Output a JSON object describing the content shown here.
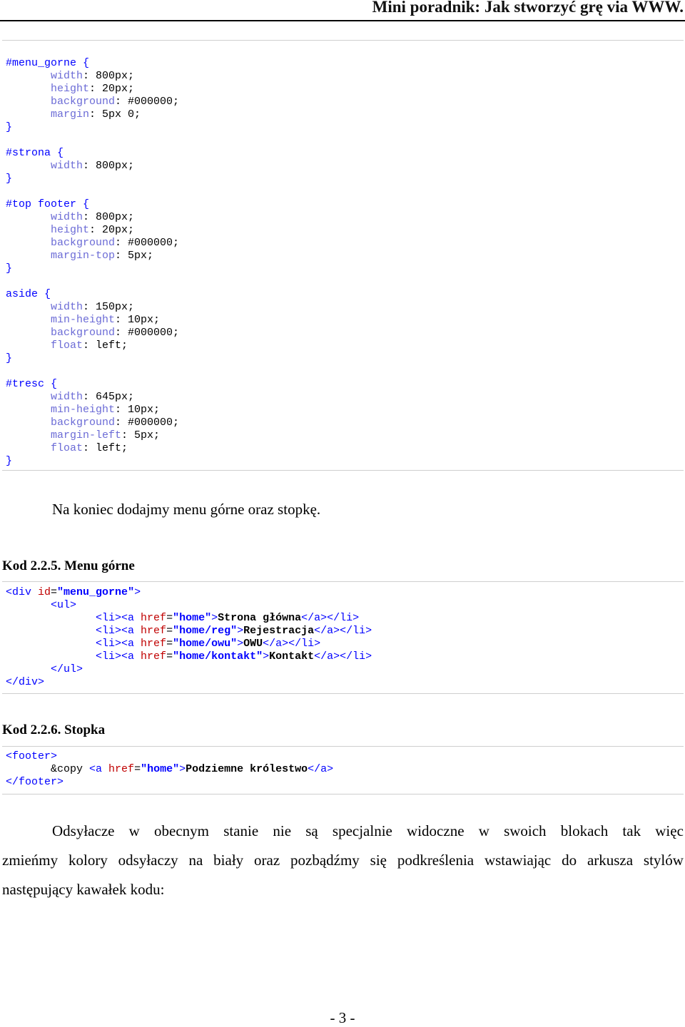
{
  "header": {
    "title": "Mini poradnik: Jak stworzyć grę via WWW."
  },
  "css_code": [
    [
      [
        "c-sel",
        "#menu_gorne {"
      ]
    ],
    [
      [
        "c-plain",
        "       "
      ],
      [
        "c-prop",
        "width"
      ],
      [
        "c-val",
        ": 800px;"
      ]
    ],
    [
      [
        "c-plain",
        "       "
      ],
      [
        "c-prop",
        "height"
      ],
      [
        "c-val",
        ": 20px;"
      ]
    ],
    [
      [
        "c-plain",
        "       "
      ],
      [
        "c-prop",
        "background"
      ],
      [
        "c-val",
        ": #000000;"
      ]
    ],
    [
      [
        "c-plain",
        "       "
      ],
      [
        "c-prop",
        "margin"
      ],
      [
        "c-val",
        ": 5px 0;"
      ]
    ],
    [
      [
        "c-sel",
        "}"
      ]
    ],
    [
      [
        "c-plain",
        ""
      ]
    ],
    [
      [
        "c-sel",
        "#strona {"
      ]
    ],
    [
      [
        "c-plain",
        "       "
      ],
      [
        "c-prop",
        "width"
      ],
      [
        "c-val",
        ": 800px;"
      ]
    ],
    [
      [
        "c-sel",
        "}"
      ]
    ],
    [
      [
        "c-plain",
        ""
      ]
    ],
    [
      [
        "c-sel",
        "#top footer {"
      ]
    ],
    [
      [
        "c-plain",
        "       "
      ],
      [
        "c-prop",
        "width"
      ],
      [
        "c-val",
        ": 800px;"
      ]
    ],
    [
      [
        "c-plain",
        "       "
      ],
      [
        "c-prop",
        "height"
      ],
      [
        "c-val",
        ": 20px;"
      ]
    ],
    [
      [
        "c-plain",
        "       "
      ],
      [
        "c-prop",
        "background"
      ],
      [
        "c-val",
        ": #000000;"
      ]
    ],
    [
      [
        "c-plain",
        "       "
      ],
      [
        "c-prop",
        "margin-top"
      ],
      [
        "c-val",
        ": 5px;"
      ]
    ],
    [
      [
        "c-sel",
        "}"
      ]
    ],
    [
      [
        "c-plain",
        ""
      ]
    ],
    [
      [
        "c-sel",
        "aside {"
      ]
    ],
    [
      [
        "c-plain",
        "       "
      ],
      [
        "c-prop",
        "width"
      ],
      [
        "c-val",
        ": 150px;"
      ]
    ],
    [
      [
        "c-plain",
        "       "
      ],
      [
        "c-prop",
        "min-height"
      ],
      [
        "c-val",
        ": 10px;"
      ]
    ],
    [
      [
        "c-plain",
        "       "
      ],
      [
        "c-prop",
        "background"
      ],
      [
        "c-val",
        ": #000000;"
      ]
    ],
    [
      [
        "c-plain",
        "       "
      ],
      [
        "c-prop",
        "float"
      ],
      [
        "c-val",
        ": left;"
      ]
    ],
    [
      [
        "c-sel",
        "}"
      ]
    ],
    [
      [
        "c-plain",
        ""
      ]
    ],
    [
      [
        "c-sel",
        "#tresc {"
      ]
    ],
    [
      [
        "c-plain",
        "       "
      ],
      [
        "c-prop",
        "width"
      ],
      [
        "c-val",
        ": 645px;"
      ]
    ],
    [
      [
        "c-plain",
        "       "
      ],
      [
        "c-prop",
        "min-height"
      ],
      [
        "c-val",
        ": 10px;"
      ]
    ],
    [
      [
        "c-plain",
        "       "
      ],
      [
        "c-prop",
        "background"
      ],
      [
        "c-val",
        ": #000000;"
      ]
    ],
    [
      [
        "c-plain",
        "       "
      ],
      [
        "c-prop",
        "margin-left"
      ],
      [
        "c-val",
        ": 5px;"
      ]
    ],
    [
      [
        "c-plain",
        "       "
      ],
      [
        "c-prop",
        "float"
      ],
      [
        "c-val",
        ": left;"
      ]
    ],
    [
      [
        "c-sel",
        "}"
      ]
    ]
  ],
  "para_intro": "Na koniec dodajmy menu górne oraz stopkę.",
  "label_menu": "Kod 2.2.5. Menu górne",
  "menu_code": [
    [
      [
        "c-tag",
        "<div "
      ],
      [
        "c-attr",
        "id"
      ],
      [
        "c-plain",
        "="
      ],
      [
        "c-str",
        "\"menu_gorne\""
      ],
      [
        "c-tag",
        ">"
      ]
    ],
    [
      [
        "c-plain",
        "       "
      ],
      [
        "c-tag",
        "<ul>"
      ]
    ],
    [
      [
        "c-plain",
        "              "
      ],
      [
        "c-tag",
        "<li><a "
      ],
      [
        "c-attr",
        "href"
      ],
      [
        "c-plain",
        "="
      ],
      [
        "c-str",
        "\"home\""
      ],
      [
        "c-tag",
        ">"
      ],
      [
        "c-txt",
        "Strona główna"
      ],
      [
        "c-tag",
        "</a></li>"
      ]
    ],
    [
      [
        "c-plain",
        "              "
      ],
      [
        "c-tag",
        "<li><a "
      ],
      [
        "c-attr",
        "href"
      ],
      [
        "c-plain",
        "="
      ],
      [
        "c-str",
        "\"home/reg\""
      ],
      [
        "c-tag",
        ">"
      ],
      [
        "c-txt",
        "Rejestracja"
      ],
      [
        "c-tag",
        "</a></li>"
      ]
    ],
    [
      [
        "c-plain",
        "              "
      ],
      [
        "c-tag",
        "<li><a "
      ],
      [
        "c-attr",
        "href"
      ],
      [
        "c-plain",
        "="
      ],
      [
        "c-str",
        "\"home/owu\""
      ],
      [
        "c-tag",
        ">"
      ],
      [
        "c-txt",
        "OWU"
      ],
      [
        "c-tag",
        "</a></li>"
      ]
    ],
    [
      [
        "c-plain",
        "              "
      ],
      [
        "c-tag",
        "<li><a "
      ],
      [
        "c-attr",
        "href"
      ],
      [
        "c-plain",
        "="
      ],
      [
        "c-str",
        "\"home/kontakt\""
      ],
      [
        "c-tag",
        ">"
      ],
      [
        "c-txt",
        "Kontakt"
      ],
      [
        "c-tag",
        "</a></li>"
      ]
    ],
    [
      [
        "c-plain",
        "       "
      ],
      [
        "c-tag",
        "</ul>"
      ]
    ],
    [
      [
        "c-tag",
        "</div>"
      ]
    ]
  ],
  "label_footer": "Kod 2.2.6. Stopka",
  "footer_code": [
    [
      [
        "c-tag",
        "<footer>"
      ]
    ],
    [
      [
        "c-plain",
        "       &copy "
      ],
      [
        "c-tag",
        "<a "
      ],
      [
        "c-attr",
        "href"
      ],
      [
        "c-plain",
        "="
      ],
      [
        "c-str",
        "\"home\""
      ],
      [
        "c-tag",
        ">"
      ],
      [
        "c-txt",
        "Podziemne królestwo"
      ],
      [
        "c-tag",
        "</a>"
      ]
    ],
    [
      [
        "c-tag",
        "</footer>"
      ]
    ]
  ],
  "para_links": {
    "line1": "Odsyłacze w obecnym stanie nie są specjalnie widoczne w swoich blokach tak więc",
    "line2": "zmieńmy kolory odsyłaczy na biały oraz pozbądźmy się podkreślenia wstawiając do arkusza stylów",
    "line3": "następujący kawałek kodu:"
  },
  "page_number": "- 3 -"
}
